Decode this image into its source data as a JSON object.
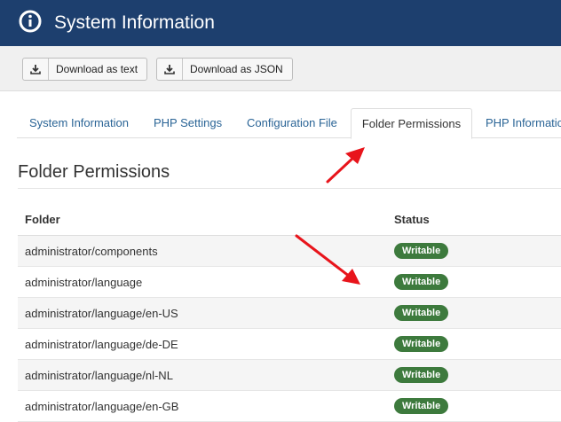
{
  "header": {
    "title": "System Information",
    "icon": "info-circle-icon",
    "background": "#1d3f6e"
  },
  "toolbar": {
    "download_text_label": "Download as text",
    "download_json_label": "Download as JSON",
    "download_icon": "download-icon"
  },
  "tabs": [
    {
      "label": "System Information",
      "active": false
    },
    {
      "label": "PHP Settings",
      "active": false
    },
    {
      "label": "Configuration File",
      "active": false
    },
    {
      "label": "Folder Permissions",
      "active": true
    },
    {
      "label": "PHP Information",
      "active": false
    }
  ],
  "main": {
    "heading": "Folder Permissions",
    "columns": {
      "folder": "Folder",
      "status": "Status"
    },
    "rows": [
      {
        "folder": "administrator/components",
        "status": "Writable"
      },
      {
        "folder": "administrator/language",
        "status": "Writable"
      },
      {
        "folder": "administrator/language/en-US",
        "status": "Writable"
      },
      {
        "folder": "administrator/language/de-DE",
        "status": "Writable"
      },
      {
        "folder": "administrator/language/nl-NL",
        "status": "Writable"
      },
      {
        "folder": "administrator/language/en-GB",
        "status": "Writable"
      }
    ],
    "badge_color": "#3d7a3d"
  },
  "annotations": {
    "arrow_color": "#e8141b"
  }
}
